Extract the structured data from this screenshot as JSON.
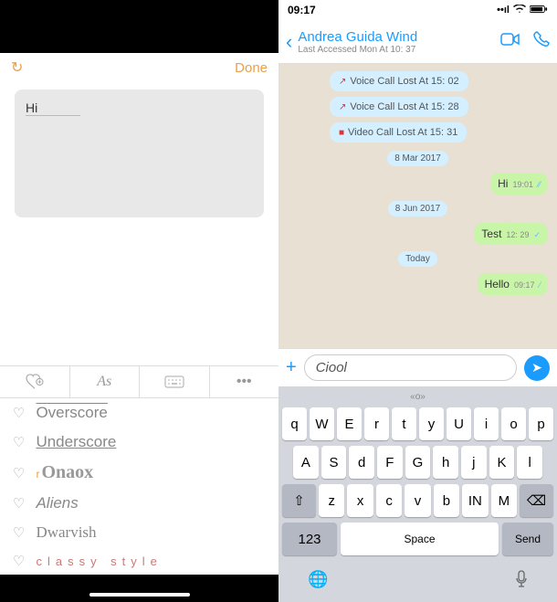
{
  "left": {
    "header": {
      "done": "Done"
    },
    "note": {
      "text": "Hi"
    },
    "toolbar": {
      "text_style": "As",
      "dots": "•••"
    },
    "fonts": [
      {
        "label": "Overscore",
        "style": "overscore"
      },
      {
        "label": "Underscore",
        "style": "underscore"
      },
      {
        "label": "Onaox",
        "style": "onaox",
        "prefix": "r"
      },
      {
        "label": "Aliens",
        "style": "aliens"
      },
      {
        "label": "Dwarvish",
        "style": "dwarvish"
      },
      {
        "label": "classy style",
        "style": "classy"
      }
    ]
  },
  "right": {
    "status": {
      "time": "09:17"
    },
    "header": {
      "contact": "Andrea Guida Wind",
      "last_access": "Last Accessed Mon At 10: 37"
    },
    "calls": [
      {
        "icon": "↗",
        "text": "Voice Call Lost At 15: 02"
      },
      {
        "icon": "↗",
        "text": "Voice Call Lost At 15: 28"
      },
      {
        "icon": "■",
        "text": "Video Call Lost At 15: 31"
      }
    ],
    "chat": [
      {
        "type": "date",
        "text": "8 Mar 2017"
      },
      {
        "type": "out",
        "text": "Hi",
        "time": "19:01",
        "checks": "⁄⁄"
      },
      {
        "type": "date",
        "text": "8 Jun 2017"
      },
      {
        "type": "out",
        "text": "Test",
        "time": "12: 29",
        "checks": "✓"
      },
      {
        "type": "date",
        "text": "Today"
      },
      {
        "type": "out",
        "text": "Hello",
        "time": "09:17",
        "checks": "⁄"
      }
    ],
    "input": {
      "text": "Ciool"
    },
    "keyboard": {
      "hint": "«o»",
      "row1": [
        "q",
        "W",
        "E",
        "r",
        "t",
        "y",
        "U",
        "i",
        "o",
        "p"
      ],
      "row2": [
        "A",
        "S",
        "d",
        "F",
        "G",
        "h",
        "j",
        "K",
        "l"
      ],
      "row3": [
        "z",
        "x",
        "c",
        "v",
        "b",
        "IN",
        "M"
      ],
      "num": "123",
      "space": "Space",
      "send": "Send"
    }
  }
}
